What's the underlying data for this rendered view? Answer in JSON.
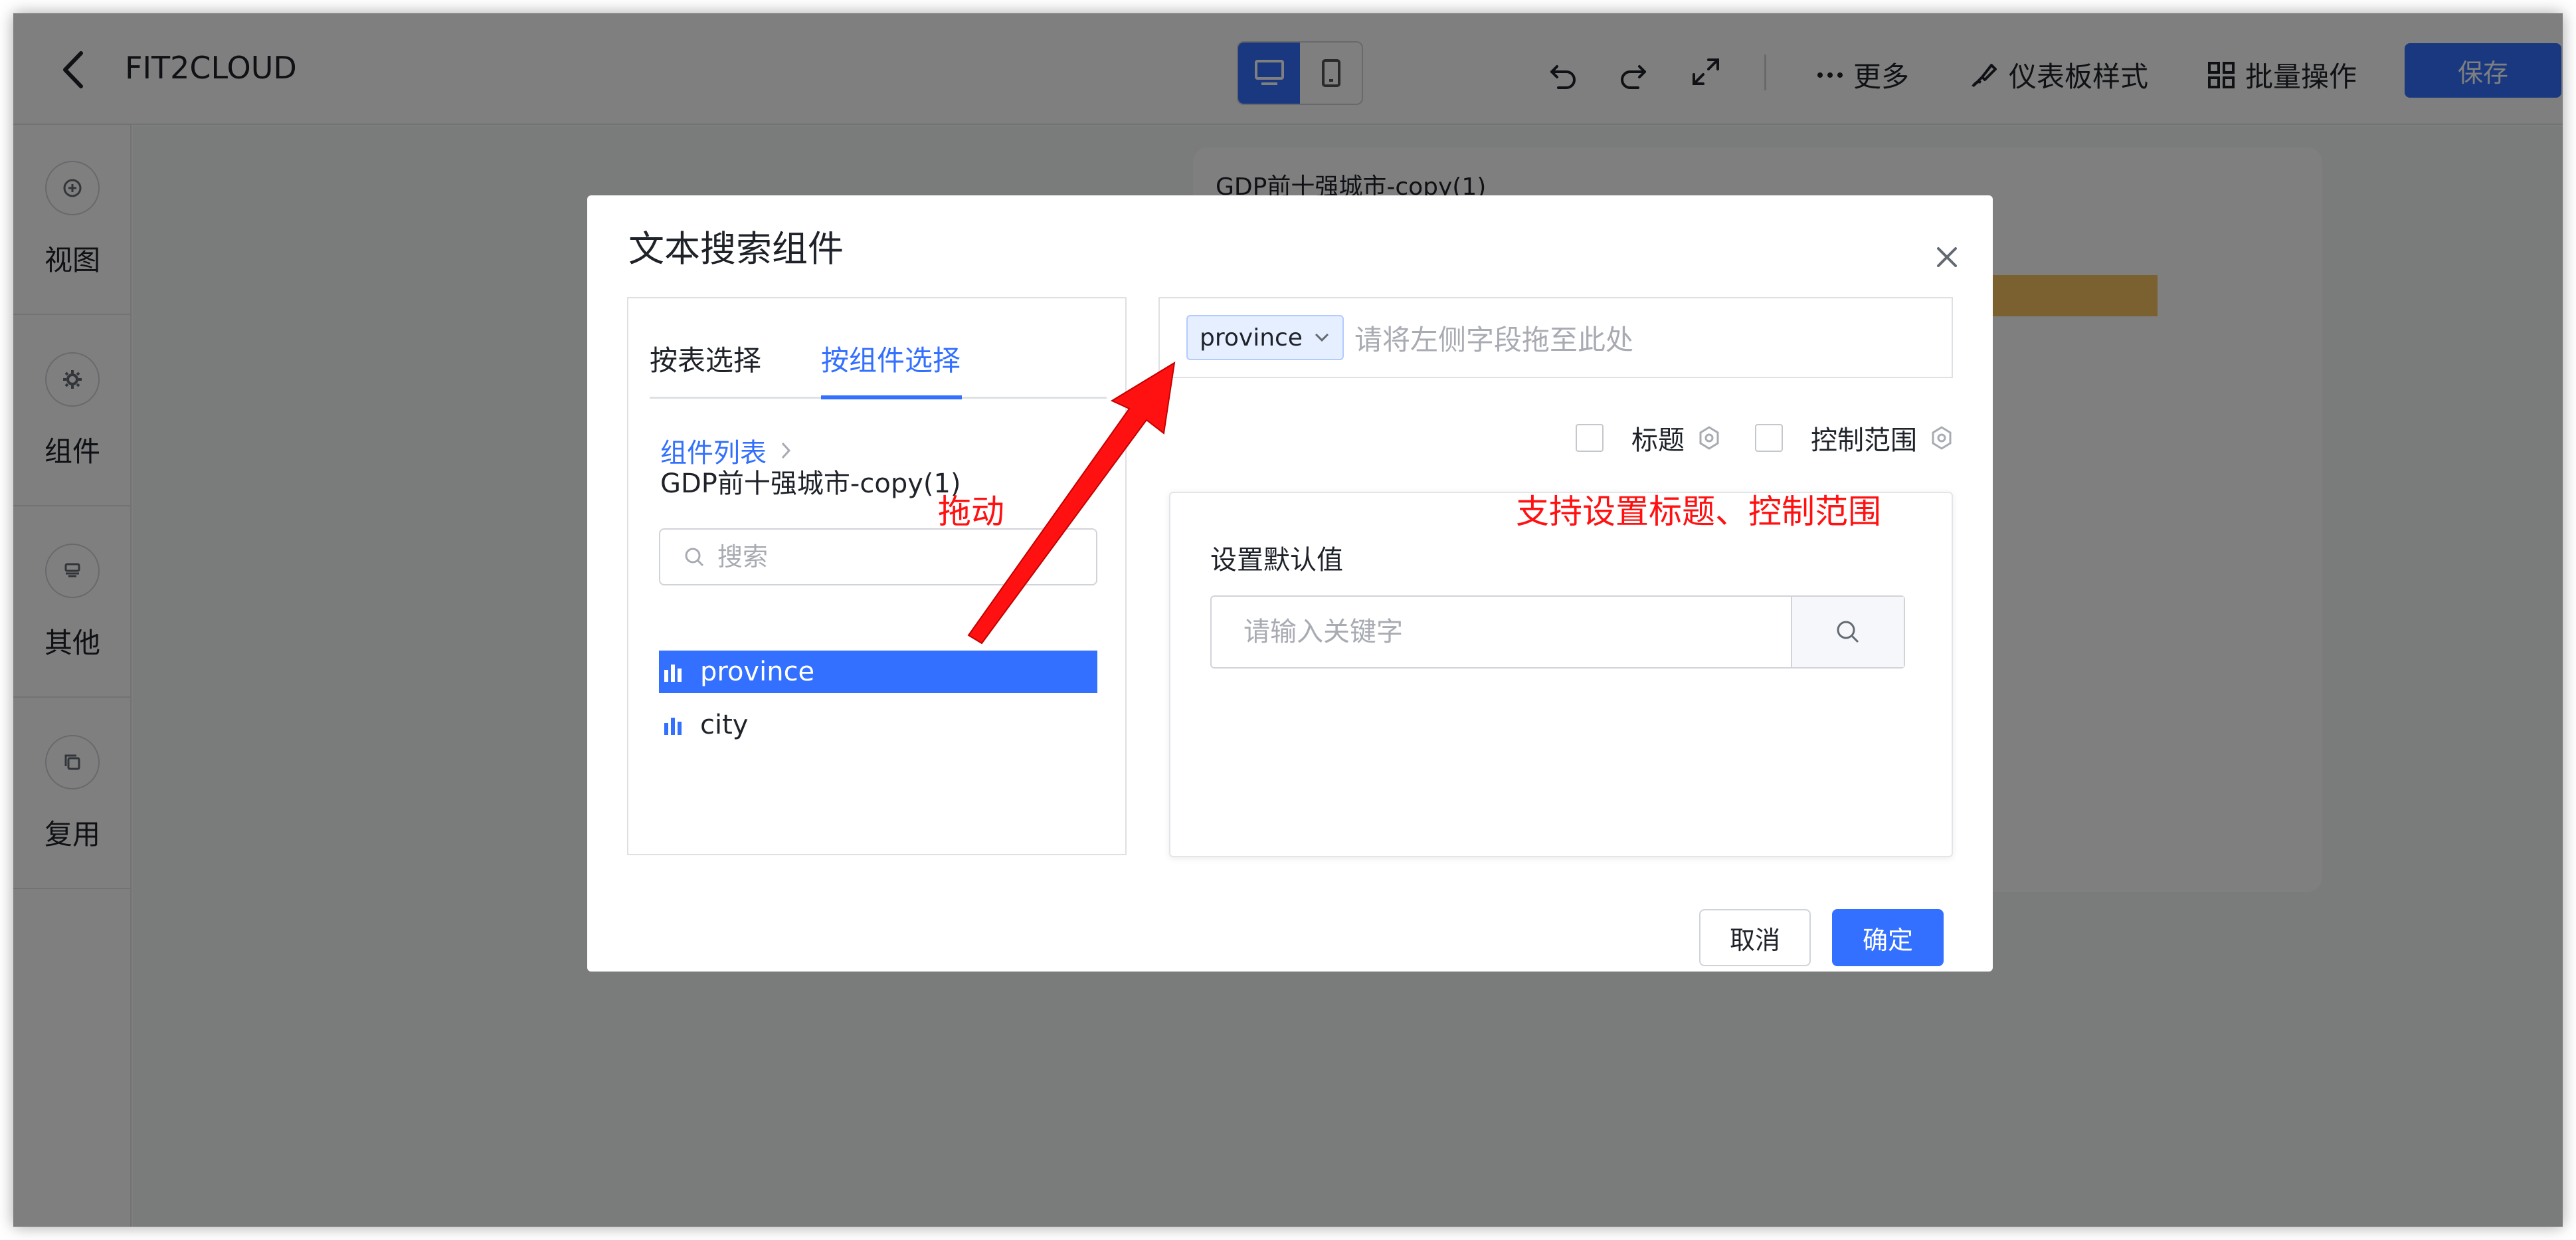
{
  "header": {
    "title": "FIT2CLOUD",
    "more_label": "更多",
    "dashboard_style_label": "仪表板样式",
    "batch_label": "批量操作",
    "save_label": "保存"
  },
  "sidebar": {
    "items": [
      {
        "label": "视图",
        "icon": "plus-circle-icon"
      },
      {
        "label": "组件",
        "icon": "gear-icon"
      },
      {
        "label": "其他",
        "icon": "layers-icon"
      },
      {
        "label": "复用",
        "icon": "copy-icon"
      }
    ]
  },
  "canvas": {
    "panel_title": "GDP前十强城市-copy(1)"
  },
  "dialog": {
    "title": "文本搜索组件",
    "tabs": [
      {
        "label": "按表选择",
        "active": false
      },
      {
        "label": "按组件选择",
        "active": true
      }
    ],
    "breadcrumb_link": "组件列表",
    "breadcrumb_current": "GDP前十强城市-copy(1)",
    "search_placeholder": "搜索",
    "fields": [
      {
        "name": "province",
        "selected": true
      },
      {
        "name": "city",
        "selected": false
      }
    ],
    "drop_tag": "province",
    "drop_placeholder": "请将左侧字段拖至此处",
    "option_title": "标题",
    "option_scope": "控制范围",
    "default_label": "设置默认值",
    "keyword_placeholder": "请输入关键字",
    "cancel_label": "取消",
    "ok_label": "确定"
  },
  "annotations": {
    "drag": "拖动",
    "support": "支持设置标题、控制范围"
  },
  "colors": {
    "accent": "#3370ff",
    "annotation": "#ff1111",
    "chart_bar": "#f6c060"
  }
}
